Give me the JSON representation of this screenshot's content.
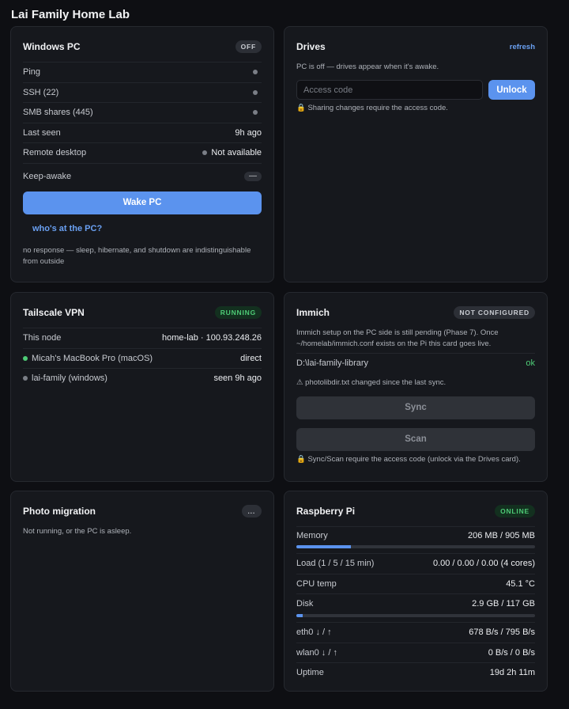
{
  "page": {
    "title": "Lai Family Home Lab"
  },
  "windows_pc": {
    "title": "Windows PC",
    "badge": "OFF",
    "rows": [
      {
        "label": "Ping",
        "value": ""
      },
      {
        "label": "SSH (22)",
        "value": ""
      },
      {
        "label": "SMB shares (445)",
        "value": ""
      },
      {
        "label": "Last seen",
        "value": "9h ago"
      },
      {
        "label": "Remote desktop",
        "value": "Not available"
      },
      {
        "label": "Keep-awake",
        "value": "—"
      }
    ],
    "wake_label": "Wake PC",
    "who_link": "who's at the PC?",
    "note": "no response — sleep, hibernate, and shutdown are indistinguishable from outside"
  },
  "drives": {
    "title": "Drives",
    "refresh_label": "refresh",
    "status": "PC is off — drives appear when it's awake.",
    "access_placeholder": "Access code",
    "unlock_label": "Unlock",
    "lock_note": "🔒 Sharing changes require the access code."
  },
  "tailscale": {
    "title": "Tailscale VPN",
    "badge": "RUNNING",
    "rows": [
      {
        "label": "This node",
        "value": "home-lab · 100.93.248.26",
        "dot": ""
      },
      {
        "label": "Micah's MacBook Pro (macOS)",
        "value": "direct",
        "dot": "green"
      },
      {
        "label": "lai-family (windows)",
        "value": "seen 9h ago",
        "dot": "gray"
      }
    ]
  },
  "immich": {
    "title": "Immich",
    "badge": "NOT CONFIGURED",
    "desc": "Immich setup on the PC side is still pending (Phase 7). Once ~/homelab/immich.conf exists on the Pi this card goes live.",
    "library_path": "D:\\lai-family-library",
    "library_status": "ok",
    "warning": "⚠ photolibdir.txt changed since the last sync.",
    "sync_label": "Sync",
    "scan_label": "Scan",
    "lock_note": "🔒 Sync/Scan require the access code (unlock via the Drives card)."
  },
  "photo_migration": {
    "title": "Photo migration",
    "menu_label": "...",
    "status": "Not running, or the PC is asleep."
  },
  "raspberry_pi": {
    "title": "Raspberry Pi",
    "badge": "ONLINE",
    "memory": {
      "label": "Memory",
      "value": "206 MB / 905 MB",
      "fraction": 0.228
    },
    "load": {
      "label": "Load (1 / 5 / 15 min)",
      "value": "0.00 / 0.00 / 0.00 (4 cores)"
    },
    "cpu_temp": {
      "label": "CPU temp",
      "value": "45.1 °C"
    },
    "disk": {
      "label": "Disk",
      "value": "2.9 GB / 117 GB",
      "fraction": 0.025
    },
    "eth0": {
      "label": "eth0 ↓ / ↑",
      "value": "678 B/s / 795 B/s"
    },
    "wlan0": {
      "label": "wlan0 ↓ / ↑",
      "value": "0 B/s / 0 B/s"
    },
    "uptime": {
      "label": "Uptime",
      "value": "19d 2h 11m"
    }
  }
}
